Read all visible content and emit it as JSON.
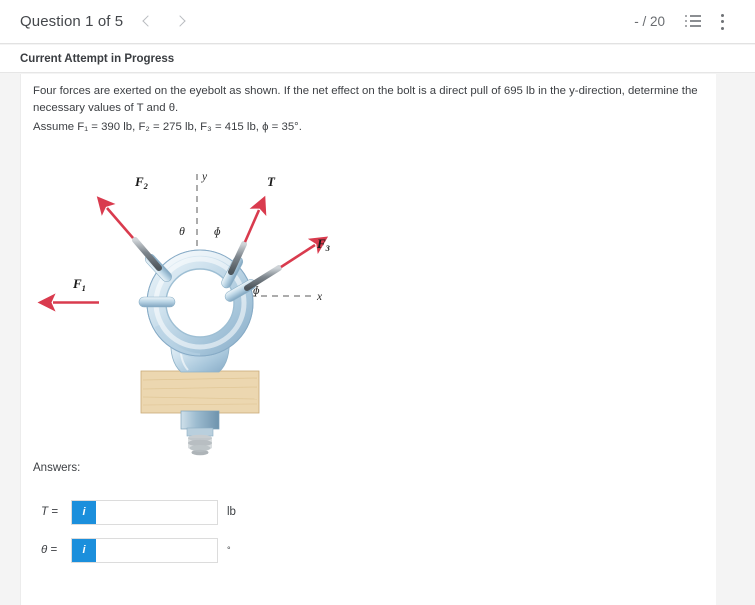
{
  "header": {
    "question_title": "Question 1 of 5",
    "prev_label": "‹",
    "next_label": "›",
    "score": "- / 20",
    "list_icon": "list-icon",
    "menu_icon": "kebab-menu-icon"
  },
  "status_bar": {
    "label": "Current Attempt in Progress"
  },
  "problem": {
    "line1": "Four forces are exerted on the eyebolt as shown. If the net effect on the bolt is a direct pull of 695 lb in the y-direction, determine the",
    "line2": "necessary values of T and θ.",
    "line3_prefix": "Assume ",
    "line3": "Assume F₁ = 390 lb, F₂ = 275 lb, F₃ = 415 lb, ϕ =  35°.",
    "values": {
      "F1": "390 lb",
      "F2": "275 lb",
      "F3": "415 lb",
      "phi": "35°",
      "net_pull": "695 lb",
      "net_direction": "y-direction"
    }
  },
  "figure": {
    "alt": "eyebolt with four force vectors",
    "labels": {
      "F1": "F",
      "F1_sub": "1",
      "F2": "F",
      "F2_sub": "2",
      "F3": "F",
      "F3_sub": "3",
      "T": "T",
      "x_axis": "x",
      "y_axis": "y",
      "theta": "θ",
      "phi_upper": "ϕ",
      "phi_lower": "ϕ"
    },
    "colors": {
      "arrow": "#d93b4e",
      "metal_light": "#dbe9f2",
      "metal_mid": "#a9c6da",
      "metal_dark": "#7ba2bd",
      "wood": "#e9d4ae",
      "axis": "#5a5a5a"
    }
  },
  "answers": {
    "heading": "Answers:",
    "rows": [
      {
        "label": "T =",
        "info_icon": "info-icon",
        "info_glyph": "i",
        "value": "",
        "placeholder": "",
        "unit": "lb"
      },
      {
        "label": "θ =",
        "info_icon": "info-icon",
        "info_glyph": "i",
        "value": "",
        "placeholder": "",
        "unit": "°"
      }
    ]
  },
  "theme": {
    "accent_blue": "#1b8fdc",
    "page_bg": "#f4f4f4",
    "card_bg": "#ffffff",
    "text": "#3c3f43"
  }
}
